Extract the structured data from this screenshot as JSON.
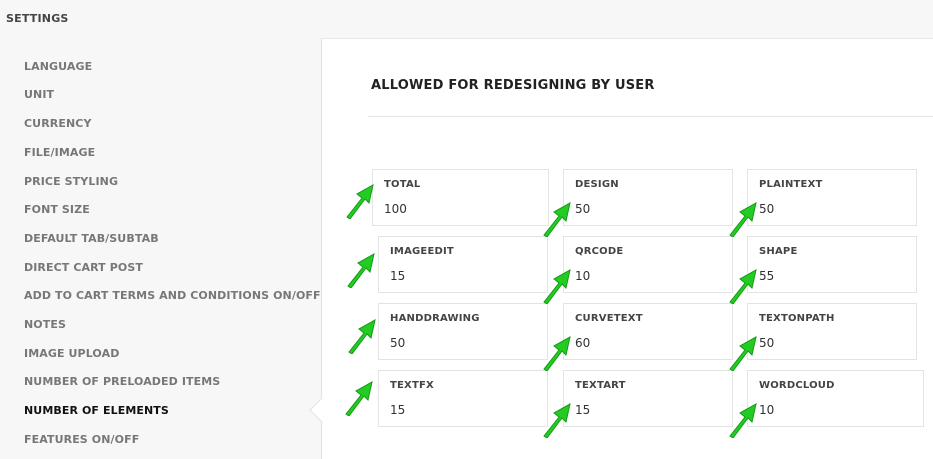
{
  "app": {
    "title": "SETTINGS"
  },
  "sidebar": {
    "items": [
      {
        "label": "LANGUAGE"
      },
      {
        "label": "UNIT"
      },
      {
        "label": "CURRENCY"
      },
      {
        "label": "FILE/IMAGE"
      },
      {
        "label": "PRICE STYLING"
      },
      {
        "label": "FONT SIZE"
      },
      {
        "label": "DEFAULT TAB/SUBTAB"
      },
      {
        "label": "DIRECT CART POST"
      },
      {
        "label": "ADD TO CART TERMS AND CONDITIONS ON/OFF"
      },
      {
        "label": "NOTES"
      },
      {
        "label": "IMAGE UPLOAD"
      },
      {
        "label": "NUMBER OF PRELOADED ITEMS"
      },
      {
        "label": "NUMBER OF ELEMENTS",
        "active": true
      },
      {
        "label": "FEATURES ON/OFF"
      }
    ]
  },
  "main": {
    "section_title": "ALLOWED FOR REDESIGNING BY USER",
    "fields": [
      {
        "label": "TOTAL",
        "value": "100"
      },
      {
        "label": "DESIGN",
        "value": "50"
      },
      {
        "label": "PLAINTEXT",
        "value": "50"
      },
      {
        "label": "IMAGEEDIT",
        "value": "15"
      },
      {
        "label": "QRCODE",
        "value": "10"
      },
      {
        "label": "SHAPE",
        "value": "55"
      },
      {
        "label": "HANDDRAWING",
        "value": "50"
      },
      {
        "label": "CURVETEXT",
        "value": "60"
      },
      {
        "label": "TEXTONPATH",
        "value": "50"
      },
      {
        "label": "TEXTFX",
        "value": "15"
      },
      {
        "label": "TEXTART",
        "value": "15"
      },
      {
        "label": "WORDCLOUD",
        "value": "10"
      }
    ]
  },
  "colors": {
    "arrow": "#22cc22",
    "arrow_dark": "#159915",
    "active_text": "#111111",
    "sidebar_text": "#777777"
  }
}
